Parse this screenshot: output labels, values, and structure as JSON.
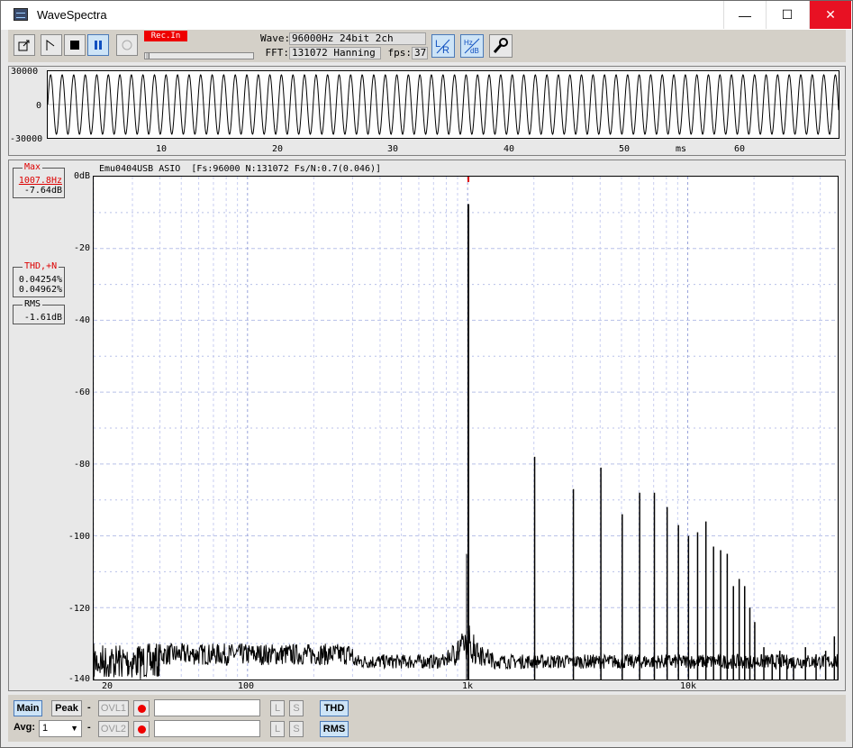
{
  "window": {
    "title": "WaveSpectra",
    "minimize": "—",
    "maximize": "☐",
    "close": "✕"
  },
  "toolbar": {
    "rec_in": "Rec.In",
    "wave_label": "Wave:",
    "wave_value": "96000Hz 24bit 2ch",
    "fft_label": "FFT:",
    "fft_value": "131072 Hanning",
    "fps_label": "fps:",
    "fps_value": "37"
  },
  "wave": {
    "y_ticks": [
      "30000",
      "0",
      "-30000"
    ],
    "x_ticks": [
      "10",
      "20",
      "30",
      "40",
      "50",
      "60"
    ],
    "x_unit": "ms",
    "frequency_hz": 1007.8
  },
  "spectrum": {
    "header": "Emu0404USB ASIO  [Fs:96000 N:131072 Fs/N:0.7(0.046)]",
    "y_ticks": [
      "0dB",
      "-20",
      "-40",
      "-60",
      "-80",
      "-100",
      "-120",
      "-140"
    ],
    "x_ticks": [
      "20",
      "100",
      "1k",
      "10k"
    ]
  },
  "measurements": {
    "max_title": "Max",
    "max_freq": "1007.8Hz",
    "max_db": "-7.64dB",
    "thd_title": "THD,+N",
    "thd_value": "0.04254%",
    "thdn_value": "0.04962%",
    "rms_title": "RMS",
    "rms_value": "-1.61dB"
  },
  "bottom": {
    "main": "Main",
    "peak": "Peak",
    "avg_label": "Avg:",
    "avg_value": "1",
    "ovl1": "OVL1",
    "ovl2": "OVL2",
    "dash": "-",
    "l": "L",
    "s": "S",
    "thd": "THD",
    "rms": "RMS"
  },
  "chart_data": {
    "type": "line",
    "xlabel": "",
    "ylabel": "",
    "x_scale": "log",
    "xlim": [
      20,
      48000
    ],
    "ylim": [
      -140,
      0
    ],
    "grid": true,
    "harmonics": [
      {
        "freq": 1007.8,
        "db": -7.64
      },
      {
        "freq": 2015.6,
        "db": -78
      },
      {
        "freq": 3023.4,
        "db": -87
      },
      {
        "freq": 4031.2,
        "db": -81
      },
      {
        "freq": 5039,
        "db": -94
      },
      {
        "freq": 6046.8,
        "db": -88
      },
      {
        "freq": 7054.6,
        "db": -88
      },
      {
        "freq": 8062.4,
        "db": -92
      },
      {
        "freq": 9070.2,
        "db": -97
      },
      {
        "freq": 10078,
        "db": -100
      },
      {
        "freq": 11085.8,
        "db": -99
      },
      {
        "freq": 12093.6,
        "db": -96
      },
      {
        "freq": 13101.4,
        "db": -103
      },
      {
        "freq": 14109.2,
        "db": -104
      },
      {
        "freq": 15117,
        "db": -105
      },
      {
        "freq": 16124.8,
        "db": -114
      },
      {
        "freq": 17132.6,
        "db": -112
      },
      {
        "freq": 18140.4,
        "db": -114
      },
      {
        "freq": 19148.2,
        "db": -120
      },
      {
        "freq": 20156,
        "db": -124
      },
      {
        "freq": 22171.6,
        "db": -131
      },
      {
        "freq": 24187.2,
        "db": -133
      },
      {
        "freq": 26202.8,
        "db": -132
      },
      {
        "freq": 28218.4,
        "db": -134
      },
      {
        "freq": 30234,
        "db": -135
      },
      {
        "freq": 34265.2,
        "db": -131
      },
      {
        "freq": 38296.4,
        "db": -133
      },
      {
        "freq": 42327.6,
        "db": -132
      },
      {
        "freq": 46358.8,
        "db": -128
      }
    ],
    "noise_floor_db": -137,
    "low_freq_noise_db": -130
  }
}
